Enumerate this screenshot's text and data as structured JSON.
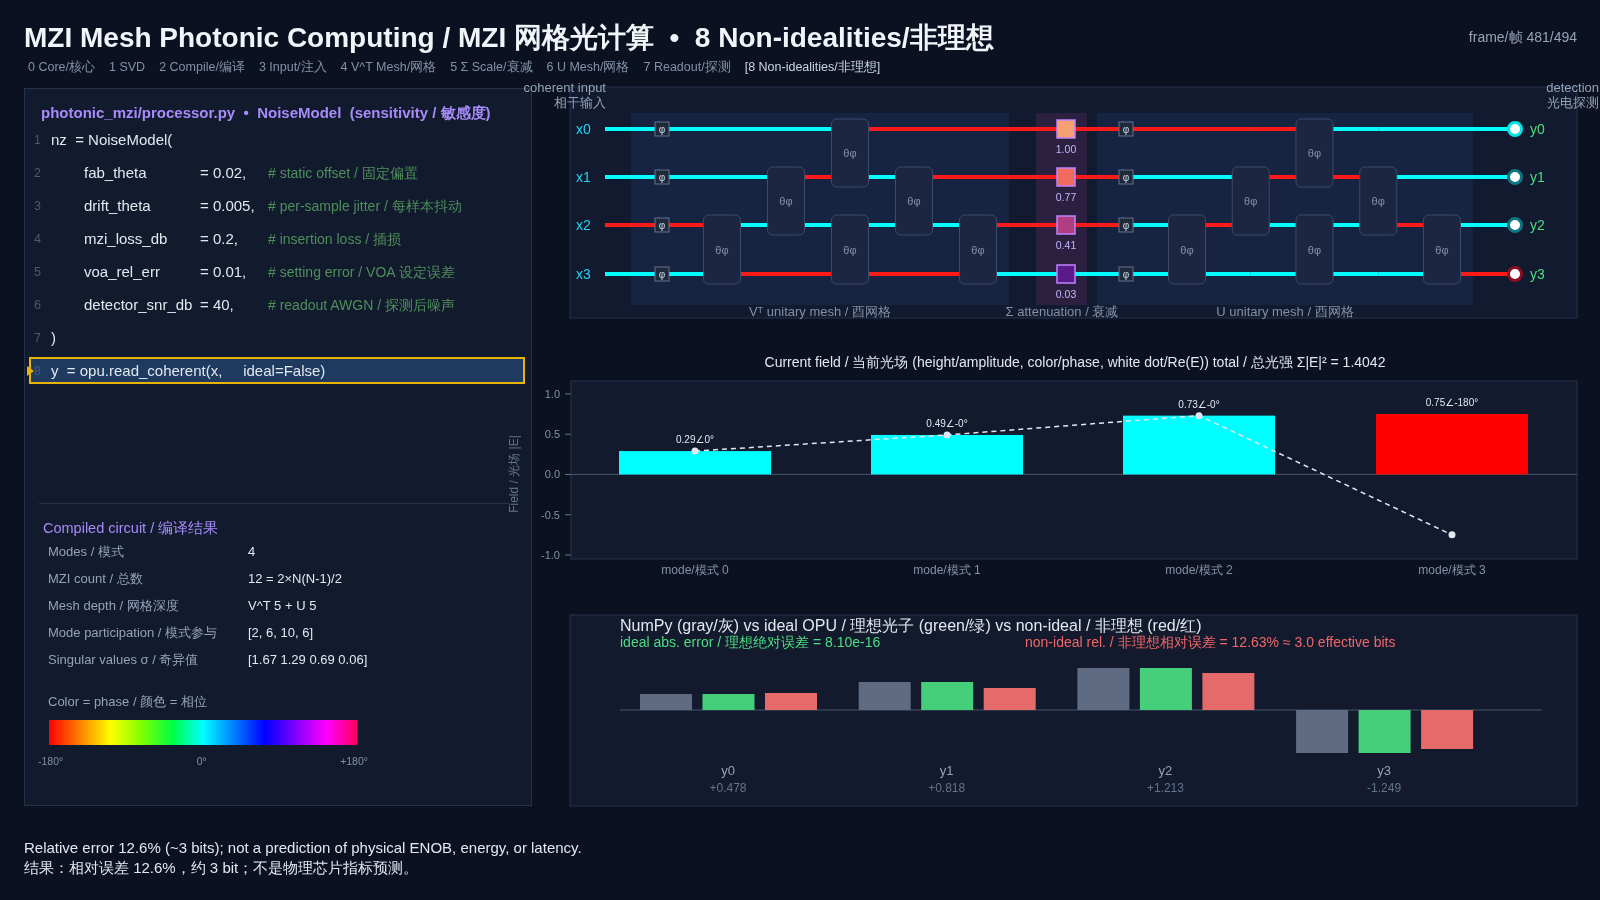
{
  "header": {
    "title": "MZI Mesh Photonic Computing / MZI 网格光计算  •  8 Non-idealities/非理想",
    "frame": "frame/帧 481/494"
  },
  "tabs": [
    {
      "label": "0 Core/核心",
      "selected": false
    },
    {
      "label": "1 SVD",
      "selected": false
    },
    {
      "label": "2 Compile/编译",
      "selected": false
    },
    {
      "label": "3 Input/注入",
      "selected": false
    },
    {
      "label": "4 V^T Mesh/网格",
      "selected": false
    },
    {
      "label": "5 Σ Scale/衰减",
      "selected": false
    },
    {
      "label": "6 U Mesh/网格",
      "selected": false
    },
    {
      "label": "7 Readout/探测",
      "selected": false
    },
    {
      "label": "[8 Non-idealities/非理想]",
      "selected": true
    }
  ],
  "code_panel": {
    "title": "photonic_mzi/processor.py  •  NoiseModel  (sensitivity / 敏感度)",
    "lines": [
      {
        "number": "1",
        "kind": "statement",
        "code": "nz  = NoiseModel(",
        "selected": false
      },
      {
        "number": "2",
        "kind": "param",
        "code": "fab_theta",
        "value": "= 0.02,",
        "comment": "# static offset / 固定偏置",
        "selected": false
      },
      {
        "number": "3",
        "kind": "param",
        "code": "drift_theta",
        "value": "= 0.005,",
        "comment": "# per-sample jitter / 每样本抖动",
        "selected": false
      },
      {
        "number": "4",
        "kind": "param",
        "code": "mzi_loss_db",
        "value": "= 0.2,",
        "comment": "# insertion loss / 插损",
        "selected": false
      },
      {
        "number": "5",
        "kind": "param",
        "code": "voa_rel_err",
        "value": "= 0.01,",
        "comment": "# setting error / VOA 设定误差",
        "selected": false
      },
      {
        "number": "6",
        "kind": "param",
        "code": "detector_snr_db",
        "value": "= 40,",
        "comment": "# readout AWGN / 探测后噪声",
        "selected": false
      },
      {
        "number": "7",
        "kind": "statement",
        "code": ")",
        "selected": false
      },
      {
        "number": "8",
        "kind": "statement",
        "code": "y  = opu.read_coherent(x,     ideal=False)",
        "selected": true
      }
    ]
  },
  "compiled": {
    "title": "Compiled circuit / 编译结果",
    "rows": [
      {
        "label": "Modes / 模式",
        "value": "4"
      },
      {
        "label": "MZI count / 总数",
        "value": "12 = 2×N(N-1)/2"
      },
      {
        "label": "Mesh depth / 网格深度",
        "value": "V^T 5 + U 5"
      },
      {
        "label": "Mode participation / 模式参与",
        "value": "[2, 6, 10, 6]"
      },
      {
        "label": "Singular values σ / 奇异值",
        "value": "[1.67 1.29 0.69 0.06]"
      }
    ]
  },
  "colorbar": {
    "label": "Color = phase / 颜色 = 相位",
    "ticks": [
      "-180°",
      "0°",
      "+180°"
    ]
  },
  "mesh": {
    "input_label": "coherent input",
    "input_label_zh": "相干输入",
    "output_label": "detection",
    "output_label_zh": "光电探测",
    "regions": [
      {
        "kind": "vt",
        "label": "Vᵀ unitary mesh / 酉网格"
      },
      {
        "kind": "sigma",
        "label": "Σ attenuation / 衰减"
      },
      {
        "kind": "u",
        "label": "U unitary mesh / 酉网格"
      }
    ],
    "modes": [
      {
        "input": "x0",
        "output": "y0",
        "phases": [
          "φ",
          "φ"
        ],
        "color": "#00e5e5",
        "segments": [
          {
            "color": "#00ffff"
          },
          {
            "color": "#00ffff"
          },
          {
            "color": "#00ffff"
          },
          {
            "color": "#00ffff"
          },
          {
            "color": "#ff1a1a"
          },
          {
            "color": "#ff1a1a"
          },
          {
            "color": "#ff1a1a"
          },
          {
            "color": "#ff1a1a"
          },
          {
            "color": "#ff1a1a"
          },
          {
            "color": "#ff1a1a"
          },
          {
            "color": "#ff1a1a"
          },
          {
            "color": "#00ffff"
          },
          {
            "color": "#00ffff"
          },
          {
            "color": "#00ffff"
          }
        ]
      },
      {
        "input": "x1",
        "output": "y1",
        "phases": [
          "φ",
          "φ"
        ],
        "color": "#0e7580",
        "segments": [
          {
            "color": "#00ffff"
          },
          {
            "color": "#00ffff"
          },
          {
            "color": "#00ffff"
          },
          {
            "color": "#ff1a1a"
          },
          {
            "color": "#00ffff"
          },
          {
            "color": "#ff1a1a"
          },
          {
            "color": "#ff1a1a"
          },
          {
            "color": "#ff1a1a"
          },
          {
            "color": "#00ffff"
          },
          {
            "color": "#00ffff"
          },
          {
            "color": "#ff1a1a"
          },
          {
            "color": "#ff1a1a"
          },
          {
            "color": "#00ffff"
          },
          {
            "color": "#00ffff"
          }
        ]
      },
      {
        "input": "x2",
        "output": "y2",
        "phases": [
          "φ",
          "φ"
        ],
        "color": "#0e7580",
        "segments": [
          {
            "color": "#ff1a1a"
          },
          {
            "color": "#ff1a1a"
          },
          {
            "color": "#00ffff"
          },
          {
            "color": "#00ffff"
          },
          {
            "color": "#00ffff"
          },
          {
            "color": "#00ffff"
          },
          {
            "color": "#ff1a1a"
          },
          {
            "color": "#ff1a1a"
          },
          {
            "color": "#00ffff"
          },
          {
            "color": "#ff1a1a"
          },
          {
            "color": "#00ffff"
          },
          {
            "color": "#00ffff"
          },
          {
            "color": "#ff1a1a"
          },
          {
            "color": "#00ffff"
          }
        ]
      },
      {
        "input": "x3",
        "output": "y3",
        "phases": [
          "φ",
          "φ"
        ],
        "color": "#8a1020",
        "segments": [
          {
            "color": "#00ffff"
          },
          {
            "color": "#00ffff"
          },
          {
            "color": "#ff1a1a"
          },
          {
            "color": "#ff1a1a"
          },
          {
            "color": "#ff1a1a"
          },
          {
            "color": "#ff1a1a"
          },
          {
            "color": "#00ffff"
          },
          {
            "color": "#00ffff"
          },
          {
            "color": "#00ffff"
          },
          {
            "color": "#00ffff"
          },
          {
            "color": "#00ffff"
          },
          {
            "color": "#00ffff"
          },
          {
            "color": "#00ffff"
          },
          {
            "color": "#ff1a1a"
          }
        ]
      }
    ],
    "mzis": [
      {
        "label": "θφ"
      },
      {
        "label": "θφ"
      },
      {
        "label": "θφ"
      },
      {
        "label": "θφ"
      },
      {
        "label": "θφ"
      },
      {
        "label": "θφ"
      },
      {
        "label": "θφ"
      },
      {
        "label": "θφ"
      },
      {
        "label": "θφ"
      },
      {
        "label": "θφ"
      },
      {
        "label": "θφ"
      },
      {
        "label": "θφ"
      }
    ],
    "attenuators": [
      {
        "value": "1.00",
        "color": "#f5a070"
      },
      {
        "value": "0.77",
        "color": "#ef6b5e"
      },
      {
        "value": "0.41",
        "color": "#b03f82"
      },
      {
        "value": "0.03",
        "color": "#5b1a8c"
      }
    ]
  },
  "field_chart": {
    "chart_data": {
      "type": "bar",
      "title": "Current field / 当前光场 (height/amplitude, color/phase, white dot/Re(E))   total / 总光强 Σ|E|² = 1.4042",
      "ylabel": "Field / 光场 |E|",
      "categories": [
        "mode/模式 0",
        "mode/模式 1",
        "mode/模式 2",
        "mode/模式 3"
      ],
      "series": [
        {
          "type": "bar",
          "color": "#00ffff",
          "values": [
            0.29,
            0.49,
            0.73,
            null
          ]
        },
        {
          "type": "bar",
          "color": "#ff0000",
          "values": [
            null,
            null,
            null,
            0.75
          ]
        },
        {
          "type": "line",
          "line_style": "dashed",
          "marker": "circle",
          "color": "#e2e8f0",
          "values": [
            0.29,
            0.49,
            0.73,
            -0.75
          ]
        }
      ],
      "ylim": [
        -1.05,
        1.16
      ],
      "yticks": [
        {
          "value": 1,
          "label": "1.0"
        },
        {
          "value": 0.5,
          "label": "0.5"
        },
        {
          "value": 0,
          "label": "0.0"
        },
        {
          "value": -0.5,
          "label": "-0.5"
        },
        {
          "value": -1,
          "label": "-1.0"
        }
      ],
      "value_labels": [
        "0.29∠0°",
        "0.49∠-0°",
        "0.73∠-0°",
        "0.75∠-180°"
      ]
    }
  },
  "compare_chart": {
    "notes": [
      {
        "text": "ideal abs. error / 理想绝对误差 = 8.10e-16",
        "color": "#4ade80"
      },
      {
        "text": "non-ideal rel. / 非理想相对误差 = 12.63% ≈ 3.0 effective bits",
        "color": "#f06767"
      }
    ],
    "title": "NumPy (gray/灰) vs ideal OPU / 理想光子 (green/绿) vs non-ideal / 非理想 (red/红)",
    "groups": [
      {
        "label": "y0",
        "reading": "+0.478"
      },
      {
        "label": "y1",
        "reading": "+0.818"
      },
      {
        "label": "y2",
        "reading": "+1.213"
      },
      {
        "label": "y3",
        "reading": "-1.249"
      }
    ]
  },
  "footer": [
    "Relative error 12.6% (~3 bits); not a prediction of physical ENOB, energy, or latency.",
    "结果：相对误差 12.6%，约 3 bit；不是物理芯片指标预测。"
  ]
}
